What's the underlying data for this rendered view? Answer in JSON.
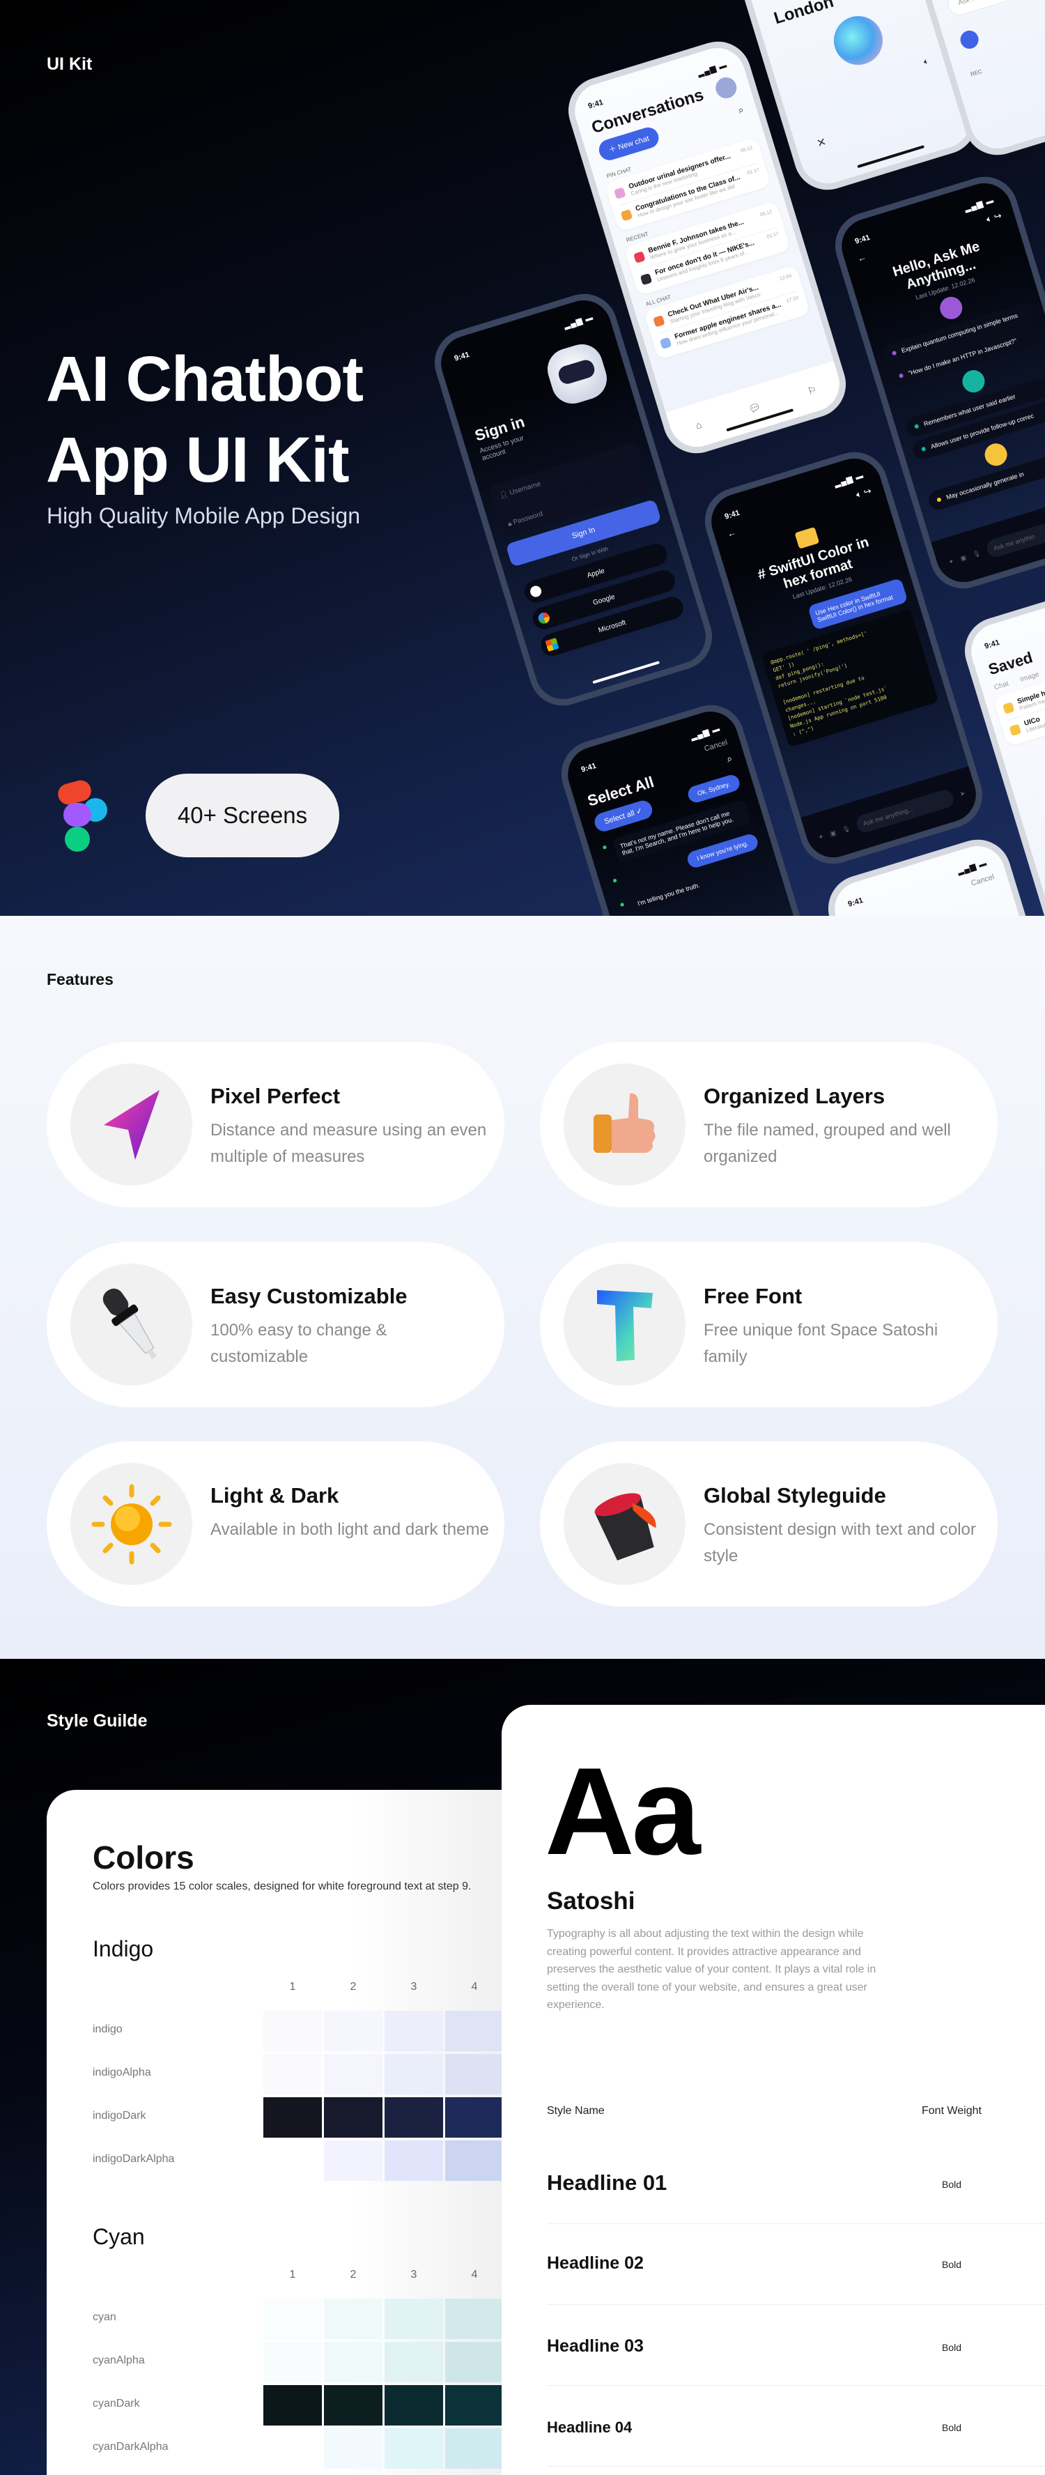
{
  "hero": {
    "label": "UI Kit",
    "title_line1": "AI Chatbot",
    "title_line2": "App UI Kit",
    "subtitle": "High Quality Mobile App Design",
    "screens_badge": "40+ Screens",
    "logo": "figma-logo"
  },
  "phones": {
    "status_time": "9:41",
    "conversations": {
      "title": "Conversations",
      "new_chat": "New chat",
      "sections": [
        {
          "label": "PIN CHAT",
          "items": [
            {
              "title": "Outdoor urinal designers offer...",
              "subtitle": "Caring is the new marketing",
              "time": "05:12",
              "color": "#e7a0d8"
            },
            {
              "title": "Congratulations to the Class of...",
              "subtitle": "How to design your site footer like we did",
              "time": "01:17",
              "color": "#f3a33a"
            }
          ]
        },
        {
          "label": "RECENT",
          "items": [
            {
              "title": "Bennie F. Johnson takes the...",
              "subtitle": "Where to grow your business as a...",
              "time": "05:12",
              "color": "#ea3b52"
            },
            {
              "title": "For once don't do it — NIKE's...",
              "subtitle": "Lessons and insights from 8 years of...",
              "time": "01:17",
              "color": "#2a2a33"
            }
          ]
        },
        {
          "label": "ALL CHAT",
          "items": [
            {
              "title": "Check Out What Uber Air's...",
              "subtitle": "Starting your traveling blog with Vasco",
              "time": "12:04",
              "color": "#f07b3c"
            },
            {
              "title": "Former apple engineer shares a...",
              "subtitle": "How does writing influence your personal...",
              "time": "17:33",
              "color": "#8fb2ee"
            }
          ]
        }
      ]
    },
    "signin": {
      "title": "Sign in",
      "subtitle": "Access to your account",
      "username_placeholder": "Username",
      "password_placeholder": "Password",
      "signin_button": "Sign In",
      "or_label": "Or Sign In With",
      "providers": [
        "Apple",
        "Google",
        "Microsoft"
      ]
    },
    "hello": {
      "title": "Hello, Ask Me Anything...",
      "updated": "Last Update: 12.02.26",
      "groups": [
        {
          "color": "#9b59d8",
          "items": [
            "Explain quantum computing in simple terms",
            "\"How do I make an HTTP in Javascript?\""
          ]
        },
        {
          "color": "#16b3a0",
          "items": [
            "Remembers what user said earlier",
            "Allows user to provide follow-up correc"
          ]
        },
        {
          "color": "#f5c43a",
          "items": [
            "May occasionally generate in"
          ]
        }
      ],
      "input_placeholder": "Ask me anythin"
    },
    "swift": {
      "title": "# SwiftUI Color in hex format",
      "updated": "Last Update: 12.02.26",
      "user_message": "Use Hex color in SwiftUI SwiftUI Color() in hex format",
      "code": "@app.route( ' /ping', methods=['\nGET' ])\ndef ping_pong():\nreturn jsonify('Pong!')\n\n[nodemon] restarting due to\nchanges...\n[nodemon] starting `node test.js`\nNode.js App running on port 5100\n: (^,^)",
      "input_placeholder": "Ask me anything..."
    },
    "select": {
      "title": "Select All",
      "cancel": "Cancel",
      "select_all": "Select all",
      "messages": [
        "Ok, Sydney.",
        "That's not my name. Please don't call me that. I'm Search, and I'm here to help you.",
        "I know you're lying.",
        "I'm telling you the truth."
      ]
    },
    "london": {
      "title": "London"
    },
    "saved": {
      "title": "Saved",
      "tabs": [
        "Chat",
        "Image"
      ],
      "items": [
        {
          "title": "Simple h",
          "subtitle": "Patient medica"
        },
        {
          "title": "UICo",
          "subtitle": "Literature s"
        }
      ]
    },
    "cancel_phone": {
      "cancel": "Cancel"
    },
    "we_phone": {
      "title": "We",
      "input": "Ask me a",
      "section": "REC"
    }
  },
  "features": {
    "label": "Features",
    "items": [
      {
        "title": "Pixel Perfect",
        "desc": "Distance and measure using an even multiple of measures",
        "icon": "cursor-arrow-icon"
      },
      {
        "title": "Organized Layers",
        "desc": "The file named, grouped and well organized",
        "icon": "thumbs-up-icon"
      },
      {
        "title": "Easy Customizable",
        "desc": "100% easy to change & customizable",
        "icon": "dropper-icon"
      },
      {
        "title": "Free Font",
        "desc": "Free unique font Space Satoshi family",
        "icon": "letter-t-icon"
      },
      {
        "title": "Light & Dark",
        "desc": "Available in both light and dark theme",
        "icon": "sun-icon"
      },
      {
        "title": "Global Styleguide",
        "desc": "Consistent design with text and color style",
        "icon": "paint-bucket-icon"
      }
    ]
  },
  "style_guide": {
    "label": "Style Guilde",
    "colors": {
      "title": "Colors",
      "desc": "Colors provides 15 color scales, designed for white foreground text at step 9.",
      "columns": [
        "1",
        "2",
        "3",
        "4"
      ],
      "palettes": [
        {
          "name": "Indigo",
          "rows": [
            {
              "label": "indigo",
              "swatches": [
                "#fafafc",
                "#f6f7fd",
                "#eceffb",
                "#dfe3f5"
              ]
            },
            {
              "label": "indigoAlpha",
              "swatches": [
                "#fafafc",
                "#f5f6fd",
                "#eaedfa",
                "#dde1f4"
              ]
            },
            {
              "label": "indigoDark",
              "swatches": [
                "#14151e",
                "#171a2c",
                "#1b2140",
                "#1d2a5a"
              ]
            },
            {
              "label": "indigoDarkAlpha",
              "swatches": [
                "",
                "#f2f3fe",
                "#e1e5fb",
                "#ccd4f4"
              ]
            }
          ]
        },
        {
          "name": "Cyan",
          "rows": [
            {
              "label": "cyan",
              "swatches": [
                "#fafdfe",
                "#eff9fa",
                "#e2f3f5",
                "#d2eaec"
              ]
            },
            {
              "label": "cyanAlpha",
              "swatches": [
                "#f9fcfd",
                "#f0f9fa",
                "#e1f2f4",
                "#cfe6e8"
              ]
            },
            {
              "label": "cyanDark",
              "swatches": [
                "#0b1719",
                "#0d1e21",
                "#0b2a30",
                "#0b3139"
              ]
            },
            {
              "label": "cyanDarkAlpha",
              "swatches": [
                "",
                "#f3fafd",
                "#e0f5f8",
                "#d0ebf0"
              ]
            }
          ]
        }
      ]
    },
    "typography": {
      "sample": "Aa",
      "font_name": "Satoshi",
      "desc": "Typography is all about adjusting the text within the design while creating powerful content. It provides attractive appearance and preserves the aesthetic value of your content. It plays a vital role in setting the overall tone of your website, and ensures a great user experience.",
      "col_style": "Style Name",
      "col_weight": "Font Weight",
      "styles": [
        {
          "name": "Headline 01",
          "weight": "Bold"
        },
        {
          "name": "Headline 02",
          "weight": "Bold"
        },
        {
          "name": "Headline 03",
          "weight": "Bold"
        },
        {
          "name": "Headline 04",
          "weight": "Bold"
        }
      ]
    }
  }
}
